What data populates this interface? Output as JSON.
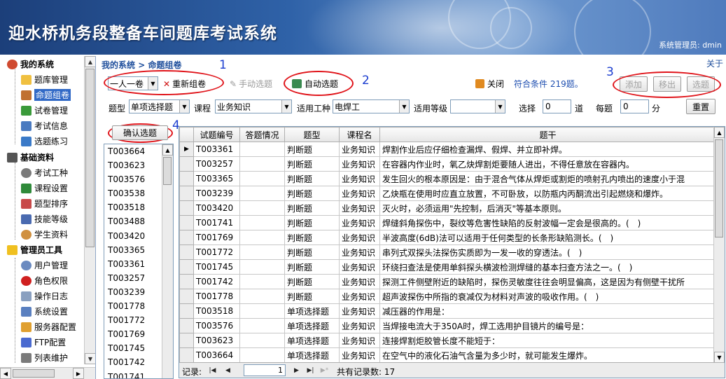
{
  "header": {
    "title": "迎水桥机务段整备车间题库考试系统",
    "user": "系统管理员: dmin"
  },
  "sidebar": {
    "groups": [
      {
        "label": "我的系统",
        "items": [
          "题库管理",
          "命题组卷",
          "试卷管理",
          "考试信息",
          "选题练习"
        ]
      },
      {
        "label": "基础资料",
        "items": [
          "考试工种",
          "课程设置",
          "题型排序",
          "技能等级",
          "学生资料"
        ]
      },
      {
        "label": "管理员工具",
        "items": [
          "用户管理",
          "角色权限",
          "操作日志",
          "系统设置",
          "服务器配置",
          "FTP配置",
          "列表维护"
        ]
      }
    ],
    "selected": "命题组卷"
  },
  "breadcrumb": {
    "home": "我的系统",
    "sep": ">",
    "current": "命题组卷"
  },
  "top_right_link": "关于",
  "annotations": [
    "1",
    "2",
    "3",
    "4"
  ],
  "toolbar": {
    "mode_value": "一人一卷",
    "regroup_label": "重新组卷",
    "manual_label": "手动选题",
    "auto_label": "自动选题",
    "close_label": "关闭",
    "match_text": "符合条件 219题。",
    "add_label": "添加",
    "remove_label": "移出",
    "select_label": "选题"
  },
  "filters": {
    "type_label": "题型",
    "type_value": "单项选择题",
    "course_label": "课程",
    "course_value": "业务知识",
    "job_label": "适用工种",
    "job_value": "电焊工",
    "level_label": "适用等级",
    "level_value": "",
    "pick_label": "选择",
    "pick_value": "0",
    "pick_unit": "道",
    "score_label": "每题",
    "score_value": "0",
    "score_unit": "分",
    "reset_label": "重置"
  },
  "confirm_label": "确认选题",
  "selected_ids": [
    "T003664",
    "T003623",
    "T003576",
    "T003538",
    "T003518",
    "T003488",
    "T003420",
    "T003365",
    "T003361",
    "T003257",
    "T003239",
    "T001778",
    "T001772",
    "T001769",
    "T001745",
    "T001742",
    "T001741"
  ],
  "grid": {
    "columns": [
      "试题编号",
      "答题情况",
      "题型",
      "课程名",
      "题干"
    ],
    "rows": [
      [
        "T003361",
        "",
        "判断题",
        "业务知识",
        "焊割作业后应仔细检查漏焊、假焊、并立即补焊。"
      ],
      [
        "T003257",
        "",
        "判断题",
        "业务知识",
        "在容器内作业时，氧乙炔焊割炬要随人进出，不得任意放在容器内。"
      ],
      [
        "T003365",
        "",
        "判断题",
        "业务知识",
        "发生回火的根本原因是：由于混合气体从焊炬或割炬的喷射孔内喷出的速度小于混"
      ],
      [
        "T003239",
        "",
        "判断题",
        "业务知识",
        "乙炔瓶在使用时应直立放置，不可卧放，以防瓶内丙酮流出引起燃烧和爆炸。"
      ],
      [
        "T003420",
        "",
        "判断题",
        "业务知识",
        "灭火时，必须运用\"先控制，后消灭\"等基本原则。"
      ],
      [
        "T001741",
        "",
        "判断题",
        "业务知识",
        "焊缝斜角探伤中，裂纹等危害性缺陷的反射波幅一定会是很高的。(　)"
      ],
      [
        "T001769",
        "",
        "判断题",
        "业务知识",
        "半波高度(6dB)法可以适用于任何类型的长条形缺陷测长。(　)"
      ],
      [
        "T001772",
        "",
        "判断题",
        "业务知识",
        "串列式双探头法探伤实质即为一发一收的穿透法。(　)"
      ],
      [
        "T001745",
        "",
        "判断题",
        "业务知识",
        "环绕扫查法是使用单斜探头横波检测焊缝的基本扫查方法之一。(　)"
      ],
      [
        "T001742",
        "",
        "判断题",
        "业务知识",
        "探测工件侧壁附近的缺陷时，探伤灵敏度往往会明显偏高，这是因为有侧壁干扰所"
      ],
      [
        "T001778",
        "",
        "判断题",
        "业务知识",
        "超声波探伤中所指的衰减仅为材料对声波的吸收作用。(　)"
      ],
      [
        "T003518",
        "",
        "单项选择题",
        "业务知识",
        "减压器的作用是："
      ],
      [
        "T003576",
        "",
        "单项选择题",
        "业务知识",
        "当焊接电流大于350A时，焊工选用护目镜片的编号是："
      ],
      [
        "T003623",
        "",
        "单项选择题",
        "业务知识",
        "连接焊割炬胶管长度不能短于："
      ],
      [
        "T003664",
        "",
        "单项选择题",
        "业务知识",
        "在空气中的液化石油气含量为多少时，就可能发生爆炸。"
      ]
    ]
  },
  "navbar": {
    "record_label": "记录:",
    "position": "1",
    "total_text": "共有记录数: 17"
  }
}
